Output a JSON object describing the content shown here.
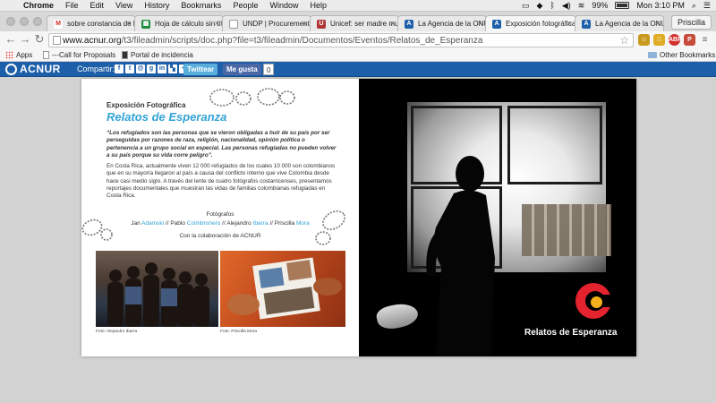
{
  "menubar": {
    "apple_glyph": "",
    "items": [
      "Chrome",
      "File",
      "Edit",
      "View",
      "History",
      "Bookmarks",
      "People",
      "Window",
      "Help"
    ],
    "battery": "99%",
    "clock": "Mon 3:10 PM"
  },
  "tabs": [
    {
      "label": "sobre constancia de h",
      "favicon": "gmail-icon",
      "color": "#d93025",
      "glyph": "M"
    },
    {
      "label": "Hoja de cálculo sin tít",
      "favicon": "sheets-icon",
      "color": "#1e8e3e",
      "glyph": "▦"
    },
    {
      "label": "UNDP | Procurement N",
      "favicon": "page-icon",
      "color": "#9aa0a6",
      "glyph": ""
    },
    {
      "label": "Unicef: ser madre mu",
      "favicon": "unicef-icon",
      "color": "#b03636",
      "glyph": "U"
    },
    {
      "label": "La Agencia de la ONU",
      "favicon": "acnur-icon",
      "color": "#1d5fa8",
      "glyph": "A"
    },
    {
      "label": "Exposición fotográfica",
      "favicon": "acnur-icon",
      "color": "#1d5fa8",
      "glyph": "A"
    },
    {
      "label": "La Agencia de la ONU",
      "favicon": "acnur-icon",
      "color": "#1d5fa8",
      "glyph": "A"
    }
  ],
  "profile": "Priscilla",
  "toolbar": {
    "url_domain": "www.acnur.org",
    "url_path": "/t3/fileadmin/scripts/doc.php?file=t3/fileadmin/Documentos/Eventos/Relatos_de_Esperanza"
  },
  "bookmarks": {
    "apps": "Apps",
    "items": [
      "---Call for Proposals",
      "Portal de incidencia"
    ],
    "other": "Other Bookmarks"
  },
  "sharebar": {
    "logo": "ACNUR",
    "share_label": "Compartir:",
    "twitter": "Twittear",
    "facebook": "Me gusta",
    "like_count": "0"
  },
  "document": {
    "subtitle": "Exposición Fotográfica",
    "title": "Relatos de Esperanza",
    "quote": "“Los refugiados son las personas que se vieron obligadas a huir de su país por ser perseguidas por razones de raza, religión, nacionalidad, opinión política o pertenencia a un grupo social en especial. Las personas refugiadas no pueden volver a su país porque su vida corre peligro”.",
    "body": "En Costa Rica, actualmente viven 12 000 refugiados de los cuales 10 000 son colombianos que en su mayoría llegaron al país a causa del conflicto interno que vive Colombia desde hace casi medio siglo. A través del lente de cuatro fotógrafos costarricenses, presentamos reportajes documentales que muestran las vidas de familias colombianas refugiadas en Costa Rica.",
    "photographers_heading": "Fotógrafos",
    "photographers": [
      {
        "first": "Jan",
        "last": "Adamski"
      },
      {
        "first": "Pablo",
        "last": "Coimbronero"
      },
      {
        "first": "Alejandro",
        "last": "Ibarra"
      },
      {
        "first": "Priscilla",
        "last": "Mora"
      }
    ],
    "separator": "//",
    "collaboration": "Con la colaboración de ACNUR",
    "caption_1": "Foto: Alejandro Ibarra",
    "caption_2": "Foto: Priscilla Mora",
    "right_title": "Relatos de Esperanza"
  }
}
